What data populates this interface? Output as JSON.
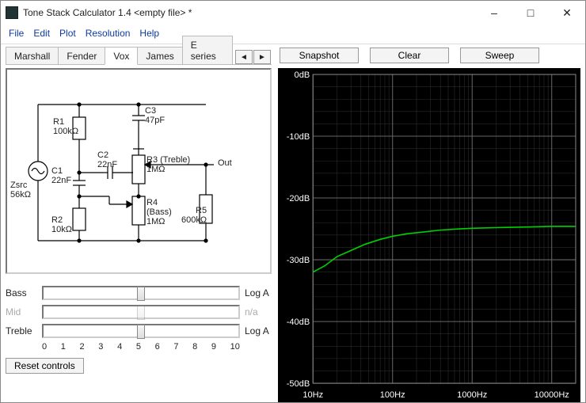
{
  "window": {
    "title": "Tone Stack Calculator 1.4 <empty file> *"
  },
  "menu": {
    "file": "File",
    "edit": "Edit",
    "plot": "Plot",
    "resolution": "Resolution",
    "help": "Help"
  },
  "tabs": {
    "t0": "Marshall",
    "t1": "Fender",
    "t2": "Vox",
    "t3": "James",
    "t4": "E series",
    "active_index": 2
  },
  "schematic": {
    "zsrc_label": "Zsrc",
    "zsrc_value": "56kΩ",
    "r1_label": "R1",
    "r1_value": "100kΩ",
    "c1_label": "C1",
    "c1_value": "22nF",
    "c2_label": "C2",
    "c2_value": "22nF",
    "c3_label": "C3",
    "c3_value": "47pF",
    "r2_label": "R2",
    "r2_value": "10kΩ",
    "r3_label": "R3 (Treble)",
    "r3_value": "1MΩ",
    "r4_label": "R4",
    "r4_sub": "(Bass)",
    "r4_value": "1MΩ",
    "r5_label": "R5",
    "r5_value": "600kΩ",
    "out_label": "Out"
  },
  "controls": {
    "bass_label": "Bass",
    "bass_tag": "Log A",
    "bass_value": 5,
    "mid_label": "Mid",
    "mid_tag": "n/a",
    "mid_value": 5,
    "treble_label": "Treble",
    "treble_tag": "Log A",
    "treble_value": 5,
    "scale": [
      "0",
      "1",
      "2",
      "3",
      "4",
      "5",
      "6",
      "7",
      "8",
      "9",
      "10"
    ],
    "reset_label": "Reset controls"
  },
  "plot_buttons": {
    "snapshot": "Snapshot",
    "clear": "Clear",
    "sweep": "Sweep"
  },
  "chart_data": {
    "type": "line",
    "title": "",
    "x_axis": {
      "label": "",
      "scale": "log",
      "min": 10,
      "max": 20000,
      "ticks": [
        10,
        100,
        1000,
        10000
      ],
      "tick_labels": [
        "10Hz",
        "100Hz",
        "1000Hz",
        "10000Hz"
      ]
    },
    "y_axis": {
      "label": "",
      "min": -50,
      "max": 0,
      "ticks": [
        0,
        -10,
        -20,
        -30,
        -40,
        -50
      ],
      "tick_labels": [
        "0dB",
        "-10dB",
        "-20dB",
        "-30dB",
        "-40dB",
        "-50dB"
      ]
    },
    "series": [
      {
        "name": "response",
        "color": "#00d000",
        "x": [
          10,
          14,
          20,
          30,
          45,
          70,
          100,
          150,
          250,
          400,
          700,
          1000,
          2000,
          5000,
          10000,
          20000
        ],
        "y": [
          -32,
          -31,
          -29.5,
          -28.5,
          -27.5,
          -26.7,
          -26.2,
          -25.8,
          -25.5,
          -25.2,
          -25.0,
          -24.9,
          -24.8,
          -24.7,
          -24.6,
          -24.6
        ]
      }
    ]
  }
}
